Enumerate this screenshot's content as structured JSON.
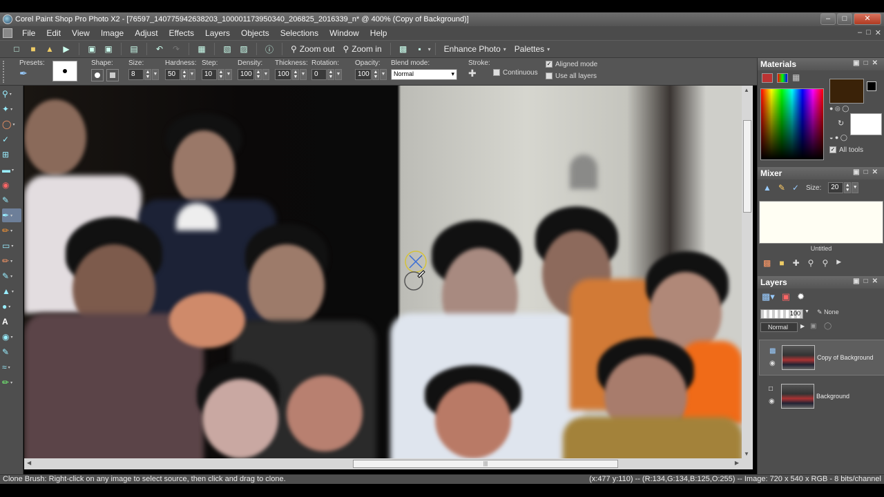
{
  "window": {
    "title": "Corel Paint Shop Pro Photo X2 - [76597_140775942638203_100001173950340_206825_2016339_n* @ 400% (Copy of Background)]",
    "min_glyph": "–",
    "max_glyph": "□",
    "close_glyph": "✕"
  },
  "menu": {
    "items": [
      "File",
      "Edit",
      "View",
      "Image",
      "Adjust",
      "Effects",
      "Layers",
      "Objects",
      "Selections",
      "Window",
      "Help"
    ],
    "mdi_controls": [
      "–",
      "□",
      "✕"
    ]
  },
  "toolbar": {
    "zoom_out_label": "Zoom out",
    "zoom_in_label": "Zoom in",
    "enhance_photo_label": "Enhance Photo",
    "palettes_label": "Palettes"
  },
  "tool_options": {
    "presets_label": "Presets:",
    "shape_label": "Shape:",
    "size_label": "Size:",
    "size_value": "8",
    "hardness_label": "Hardness:",
    "hardness_value": "50",
    "step_label": "Step:",
    "step_value": "10",
    "density_label": "Density:",
    "density_value": "100",
    "thickness_label": "Thickness:",
    "thickness_value": "100",
    "rotation_label": "Rotation:",
    "rotation_value": "0",
    "opacity_label": "Opacity:",
    "opacity_value": "100",
    "blend_mode_label": "Blend mode:",
    "blend_mode_value": "Normal",
    "stroke_label": "Stroke:",
    "continuous_label": "Continuous",
    "continuous_checked": false,
    "aligned_mode_label": "Aligned mode",
    "aligned_mode_checked": true,
    "use_all_layers_label": "Use all layers",
    "use_all_layers_checked": false
  },
  "materials": {
    "title": "Materials",
    "foreground_color": "#3a2208",
    "background_color": "#ffffff",
    "all_tools_label": "All tools",
    "all_tools_checked": true
  },
  "mixer": {
    "title": "Mixer",
    "size_label": "Size:",
    "size_value": "20",
    "untitled_label": "Untitled"
  },
  "layers": {
    "title": "Layers",
    "opacity_value": "100",
    "none_label": "None",
    "blend_label": "Normal",
    "items": [
      {
        "name": "Copy of Background",
        "selected": true
      },
      {
        "name": "Background",
        "selected": false
      }
    ]
  },
  "status": {
    "message": "Clone Brush: Right-click on any image to select source, then click and drag to clone.",
    "info": "(x:477 y:110) -- (R:134,G:134,B:125,O:255) -- Image:  720 x 540 x RGB - 8 bits/channel"
  },
  "icons": {
    "check": "✓",
    "caret": "▾"
  }
}
